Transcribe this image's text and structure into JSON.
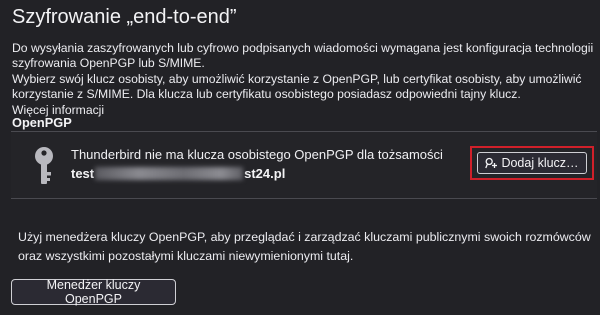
{
  "page": {
    "heading": "Szyfrowanie „end-to-end”",
    "intro_line1": "Do wysyłania zaszyfrowanych lub cyfrowo podpisanych wiadomości wymagana jest konfiguracja technologii",
    "intro_line2": "szyfrowania OpenPGP lub S/MIME.",
    "choose_line1": "Wybierz swój klucz osobisty, aby umożliwić korzystanie z OpenPGP, lub certyfikat osobisty, aby umożliwić",
    "choose_line2": "korzystanie z S/MIME. Dla klucza lub certyfikatu osobistego posiadasz odpowiedni tajny klucz.",
    "more_info_link": "Więcej informacji"
  },
  "openpgp": {
    "section_title": "OpenPGP",
    "no_key_message": "Thunderbird nie ma klucza osobistego OpenPGP dla tożsamości",
    "identity_prefix": "test",
    "identity_suffix": "st24.pl",
    "add_key_button": "Dodaj klucz…",
    "description_line1": "Użyj menedżera kluczy OpenPGP, aby przeglądać i zarządzać kluczami publicznymi swoich rozmówców",
    "description_line2": "oraz wszystkimi pozostałymi kluczami niewymienionymi tutaj.",
    "manager_button": "Menedżer kluczy OpenPGP"
  },
  "colors": {
    "background": "#222226",
    "text": "#f2f2f4",
    "highlight_border": "#d0202a",
    "key_icon": "#b8b8be"
  },
  "icons": {
    "key_large": "key-icon",
    "add_key": "key-plus-icon"
  }
}
